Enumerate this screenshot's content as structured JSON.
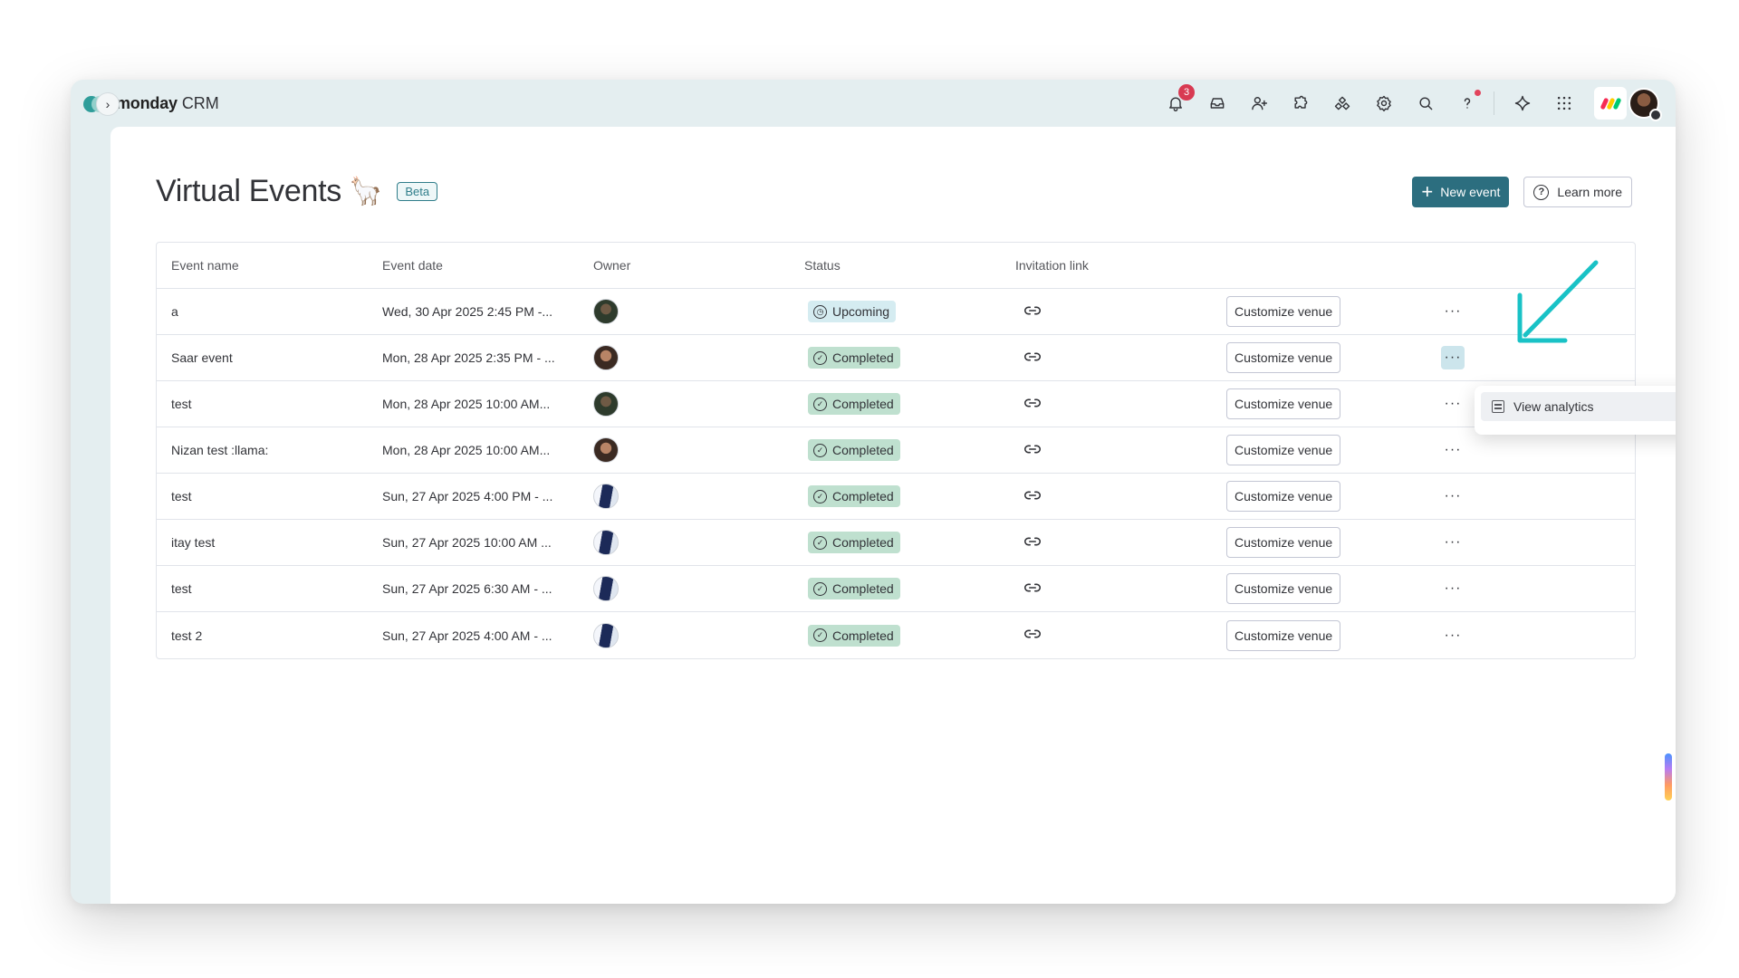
{
  "app": {
    "brand": "monday",
    "product": "CRM"
  },
  "topbar": {
    "icons": [
      "bell-icon",
      "inbox-icon",
      "invite-user-icon",
      "apps-icon",
      "integrations-icon",
      "settings-icon",
      "search-icon",
      "help-icon",
      "ai-sparkle-icon",
      "app-grid-icon"
    ],
    "notification_count": "3",
    "user_avatar": "user-avatar"
  },
  "page": {
    "title": "Virtual Events",
    "title_emoji": "🦙",
    "beta_label": "Beta",
    "new_event_label": "New event",
    "learn_more_label": "Learn more"
  },
  "table": {
    "headers": {
      "name": "Event name",
      "date": "Event date",
      "owner": "Owner",
      "status": "Status",
      "link": "Invitation link"
    },
    "venue_label": "Customize venue",
    "more_label": "···",
    "rows": [
      {
        "name": "a",
        "date": "Wed, 30 Apr 2025 2:45 PM -...",
        "status": "Upcoming",
        "owner_avatar": "av-a"
      },
      {
        "name": "Saar event",
        "date": "Mon, 28 Apr 2025 2:35 PM - ...",
        "status": "Completed",
        "owner_avatar": "av-b"
      },
      {
        "name": "test",
        "date": "Mon, 28 Apr 2025 10:00 AM...",
        "status": "Completed",
        "owner_avatar": "av-a"
      },
      {
        "name": "Nizan test :llama:",
        "date": "Mon, 28 Apr 2025 10:00 AM...",
        "status": "Completed",
        "owner_avatar": "av-b"
      },
      {
        "name": "test",
        "date": "Sun, 27 Apr 2025 4:00 PM - ...",
        "status": "Completed",
        "owner_avatar": "av-c"
      },
      {
        "name": "itay test",
        "date": "Sun, 27 Apr 2025 10:00 AM ...",
        "status": "Completed",
        "owner_avatar": "av-c"
      },
      {
        "name": "test",
        "date": "Sun, 27 Apr 2025 6:30 AM - ...",
        "status": "Completed",
        "owner_avatar": "av-c"
      },
      {
        "name": "test 2",
        "date": "Sun, 27 Apr 2025 4:00 AM - ...",
        "status": "Completed",
        "owner_avatar": "av-c"
      }
    ]
  },
  "dropdown": {
    "item_label": "View analytics"
  },
  "colors": {
    "primary": "#2c6e7f",
    "upcoming": "#d5ecf1",
    "completed": "#bfe0cf",
    "annotation_arrow": "#19c2c6",
    "badge": "#d83a52"
  }
}
